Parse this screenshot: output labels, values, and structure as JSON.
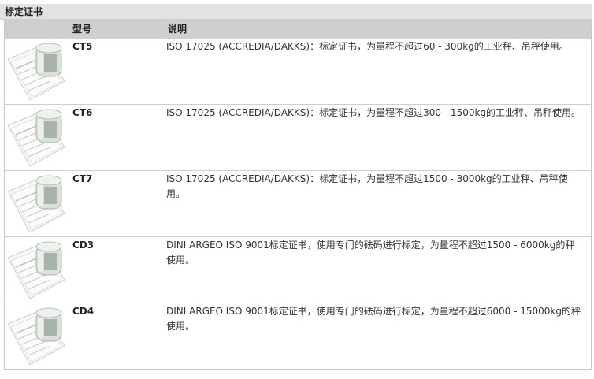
{
  "section": {
    "title": "标定证书"
  },
  "table": {
    "headers": {
      "model": "型号",
      "description": "说明"
    },
    "rows": [
      {
        "model": "CT5",
        "description": "ISO 17025 (ACCREDIA/DAKKS)：标定证书，为量程不超过60 - 300kg的工业秤、吊秤使用。"
      },
      {
        "model": "CT6",
        "description": "ISO 17025 (ACCREDIA/DAKKS)：标定证书，为量程不超过300 - 1500kg的工业秤、吊秤使用。"
      },
      {
        "model": "CT7",
        "description": "ISO 17025 (ACCREDIA/DAKKS)：标定证书，为量程不超过1500 - 3000kg的工业秤、吊秤使用。"
      },
      {
        "model": "CD3",
        "description": "DINI ARGEO ISO 9001标定证书，使用专门的砝码进行标定，为量程不超过1500 - 6000kg的秤使用。"
      },
      {
        "model": "CD4",
        "description": "DINI ARGEO ISO 9001标定证书，使用专门的砝码进行标定，为量程不超过6000 - 15000kg的秤使用。"
      }
    ]
  }
}
